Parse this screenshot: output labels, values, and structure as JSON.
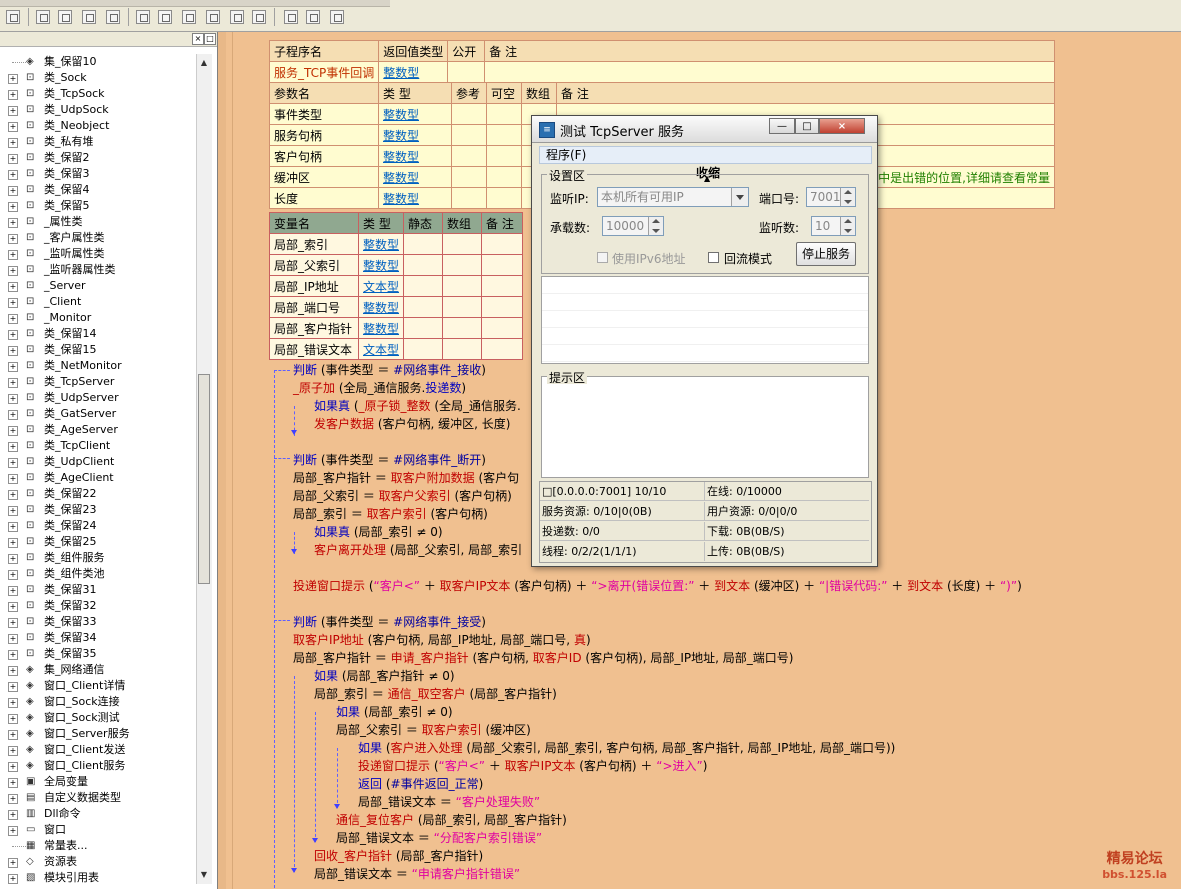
{
  "tree": {
    "items": [
      {
        "label": "集_保留10",
        "icon": "module-icon"
      },
      {
        "label": "类_Sock",
        "icon": "class-icon"
      },
      {
        "label": "类_TcpSock",
        "icon": "class-icon"
      },
      {
        "label": "类_UdpSock",
        "icon": "class-icon"
      },
      {
        "label": "类_Neobject",
        "icon": "class-icon"
      },
      {
        "label": "类_私有堆",
        "icon": "class-icon"
      },
      {
        "label": "类_保留2",
        "icon": "class-icon"
      },
      {
        "label": "类_保留3",
        "icon": "class-icon"
      },
      {
        "label": "类_保留4",
        "icon": "class-icon"
      },
      {
        "label": "类_保留5",
        "icon": "class-icon"
      },
      {
        "label": "_属性类",
        "icon": "class-icon"
      },
      {
        "label": "_客户属性类",
        "icon": "class-icon"
      },
      {
        "label": "_监听属性类",
        "icon": "class-icon"
      },
      {
        "label": "_监听器属性类",
        "icon": "class-icon"
      },
      {
        "label": "_Server",
        "icon": "class-icon"
      },
      {
        "label": "_Client",
        "icon": "class-icon"
      },
      {
        "label": "_Monitor",
        "icon": "class-icon"
      },
      {
        "label": "类_保留14",
        "icon": "class-icon"
      },
      {
        "label": "类_保留15",
        "icon": "class-icon"
      },
      {
        "label": "类_NetMonitor",
        "icon": "class-icon"
      },
      {
        "label": "类_TcpServer",
        "icon": "class-icon"
      },
      {
        "label": "类_UdpServer",
        "icon": "class-icon"
      },
      {
        "label": "类_GatServer",
        "icon": "class-icon"
      },
      {
        "label": "类_AgeServer",
        "icon": "class-icon"
      },
      {
        "label": "类_TcpClient",
        "icon": "class-icon"
      },
      {
        "label": "类_UdpClient",
        "icon": "class-icon"
      },
      {
        "label": "类_AgeClient",
        "icon": "class-icon"
      },
      {
        "label": "类_保留22",
        "icon": "class-icon"
      },
      {
        "label": "类_保留23",
        "icon": "class-icon"
      },
      {
        "label": "类_保留24",
        "icon": "class-icon"
      },
      {
        "label": "类_保留25",
        "icon": "class-icon"
      },
      {
        "label": "类_组件服务",
        "icon": "class-icon"
      },
      {
        "label": "类_组件类池",
        "icon": "class-icon"
      },
      {
        "label": "类_保留31",
        "icon": "class-icon"
      },
      {
        "label": "类_保留32",
        "icon": "class-icon"
      },
      {
        "label": "类_保留33",
        "icon": "class-icon"
      },
      {
        "label": "类_保留34",
        "icon": "class-icon"
      },
      {
        "label": "类_保留35",
        "icon": "class-icon"
      },
      {
        "label": "集_网络通信",
        "icon": "module-icon"
      },
      {
        "label": "窗口_Client详情",
        "icon": "module-icon"
      },
      {
        "label": "窗口_Sock连接",
        "icon": "module-icon"
      },
      {
        "label": "窗口_Sock测试",
        "icon": "module-icon"
      },
      {
        "label": "窗口_Server服务",
        "icon": "module-icon"
      },
      {
        "label": "窗口_Client发送",
        "icon": "module-icon"
      },
      {
        "label": "窗口_Client服务",
        "icon": "module-icon"
      },
      {
        "label": "全局变量",
        "icon": "global-icon"
      },
      {
        "label": "自定义数据类型",
        "icon": "type-icon"
      },
      {
        "label": "Dll命令",
        "icon": "dll-icon"
      },
      {
        "label": "窗口",
        "icon": "window-icon"
      },
      {
        "label": "常量表...",
        "icon": "const-icon"
      },
      {
        "label": "资源表",
        "icon": "resource-icon"
      },
      {
        "label": "模块引用表",
        "icon": "module-ref-icon"
      }
    ]
  },
  "sub_table": {
    "headers": [
      "子程序名",
      "返回值类型",
      "公开",
      "备 注"
    ],
    "row": [
      "服务_TCP事件回调",
      "整数型",
      "",
      ""
    ],
    "param_headers": [
      "参数名",
      "类 型",
      "参考",
      "可空",
      "数组",
      "备 注"
    ],
    "params": [
      [
        "事件类型",
        "整数型"
      ],
      [
        "服务句柄",
        "整数型"
      ],
      [
        "客户句柄",
        "整数型"
      ],
      [
        "缓冲区",
        "整数型"
      ],
      [
        "长度",
        "整数型"
      ]
    ],
    "comment_tail": "中是出错的位置,详细请查看常量"
  },
  "var_table": {
    "headers": [
      "变量名",
      "类 型",
      "静态",
      "数组",
      "备 注"
    ],
    "rows": [
      [
        "局部_索引",
        "整数型"
      ],
      [
        "局部_父索引",
        "整数型"
      ],
      [
        "局部_IP地址",
        "文本型"
      ],
      [
        "局部_端口号",
        "整数型"
      ],
      [
        "局部_客户指针",
        "整数型"
      ],
      [
        "局部_错误文本",
        "文本型"
      ]
    ]
  },
  "code": {
    "l1": {
      "a": "判断",
      "b": " (事件类型 ＝ ",
      "c": "#网络事件_接收",
      "d": ")"
    },
    "l2": {
      "a": "_原子加",
      "b": " (全局_通信服务.",
      "c": "投递数",
      "d": ")"
    },
    "l3": {
      "a": "如果真",
      "b": " (",
      "c": "_原子锁_整数",
      "d": " (全局_通信服务."
    },
    "l4": {
      "a": "发客户数据",
      "b": " (客户句柄, 缓冲区, 长度)"
    },
    "l5": {
      "a": "判断",
      "b": " (事件类型 ＝ ",
      "c": "#网络事件_断开",
      "d": ")"
    },
    "l6": {
      "a": "局部_客户指针 ＝ ",
      "b": "取客户附加数据",
      "c": " (客户句"
    },
    "l7": {
      "a": "局部_父索引 ＝ ",
      "b": "取客户父索引",
      "c": " (客户句柄)"
    },
    "l8": {
      "a": "局部_索引 ＝ ",
      "b": "取客户索引",
      "c": " (客户句柄)"
    },
    "l9": {
      "a": "如果真",
      "b": " (局部_索引 ≠ 0)"
    },
    "l10": {
      "a": "客户离开处理",
      "b": " (局部_父索引, 局部_索引"
    },
    "l11": {
      "a": "投递窗口提示",
      "b": " (",
      "c": "“客户<”",
      "d": " ＋ ",
      "e": "取客户IP文本",
      "f": " (客户句柄) ＋ ",
      "g": "“>离开(错误位置:”",
      "h": " ＋ ",
      "i": "到文本",
      "j": " (缓冲区) ＋ ",
      "k": "“|错误代码:”",
      "l": " ＋ ",
      "m": "到文本",
      "n": " (长度) ＋ ",
      "o": "“)”",
      "p": ")"
    },
    "l12": {
      "a": "判断",
      "b": " (事件类型 ＝ ",
      "c": "#网络事件_接受",
      "d": ")"
    },
    "l13": {
      "a": "取客户IP地址",
      "b": " (客户句柄, 局部_IP地址, 局部_端口号, ",
      "c": "真",
      "d": ")"
    },
    "l14": {
      "a": "局部_客户指针 ＝ ",
      "b": "申请_客户指针",
      "c": " (客户句柄, ",
      "d": "取客户ID",
      "e": " (客户句柄), 局部_IP地址, 局部_端口号)"
    },
    "l15": {
      "a": "如果",
      "b": " (局部_客户指针 ≠ 0)"
    },
    "l16": {
      "a": "局部_索引 ＝ ",
      "b": "通信_取空客户",
      "c": " (局部_客户指针)"
    },
    "l17": {
      "a": "如果",
      "b": " (局部_索引 ≠ 0)"
    },
    "l18": {
      "a": "局部_父索引 ＝ ",
      "b": "取客户索引",
      "c": " (缓冲区)"
    },
    "l19": {
      "a": "如果",
      "b": " (",
      "c": "客户进入处理",
      "d": " (局部_父索引, 局部_索引, 客户句柄, 局部_客户指针, 局部_IP地址, 局部_端口号))"
    },
    "l20": {
      "a": "投递窗口提示",
      "b": " (",
      "c": "“客户<”",
      "d": " ＋ ",
      "e": "取客户IP文本",
      "f": " (客户句柄) ＋ ",
      "g": "“>进入”",
      "h": ")"
    },
    "l21": {
      "a": "返回",
      "b": " (",
      "c": "#事件返回_正常",
      "d": ")"
    },
    "l22": {
      "a": "局部_错误文本 ＝ ",
      "b": "“客户处理失败”"
    },
    "l23": {
      "a": "通信_复位客户",
      "b": " (局部_索引, 局部_客户指针)"
    },
    "l24": {
      "a": "局部_错误文本 ＝ ",
      "b": "“分配客户索引错误”"
    },
    "l25": {
      "a": "回收_客户指针",
      "b": " (局部_客户指针)"
    },
    "l26": {
      "a": "局部_错误文本 ＝ ",
      "b": "“申请客户指针错误”"
    }
  },
  "dialog": {
    "title": "测试 TcpServer 服务",
    "menu": "程序(F)",
    "collapse_label": "收缩",
    "settings_legend": "设置区",
    "listen_ip_label": "监听IP:",
    "listen_ip_value": "本机所有可用IP",
    "port_label": "端口号:",
    "port_value": "7001",
    "capacity_label": "承载数:",
    "capacity_value": "10000",
    "listen_count_label": "监听数:",
    "listen_count_value": "10",
    "ipv6_label": "使用IPv6地址",
    "loopback_label": "回流模式",
    "stop_button": "停止服务",
    "hint_legend": "提示区",
    "stats": {
      "r1c1": "□[0.0.0.0:7001] 10/10",
      "r1c2": "在线: 0/10000",
      "r2c1": "服务资源: 0/10|0(0B)",
      "r2c2": "用户资源: 0/0|0/0",
      "r3c1": "投递数: 0/0",
      "r3c2": "下载: 0B(0B/S)",
      "r4c1": "线程: 0/2/2(1/1/1)",
      "r4c2": "上传: 0B(0B/S)"
    }
  },
  "watermark": {
    "line1": "精易论坛",
    "line2": "bbs.125.la"
  }
}
